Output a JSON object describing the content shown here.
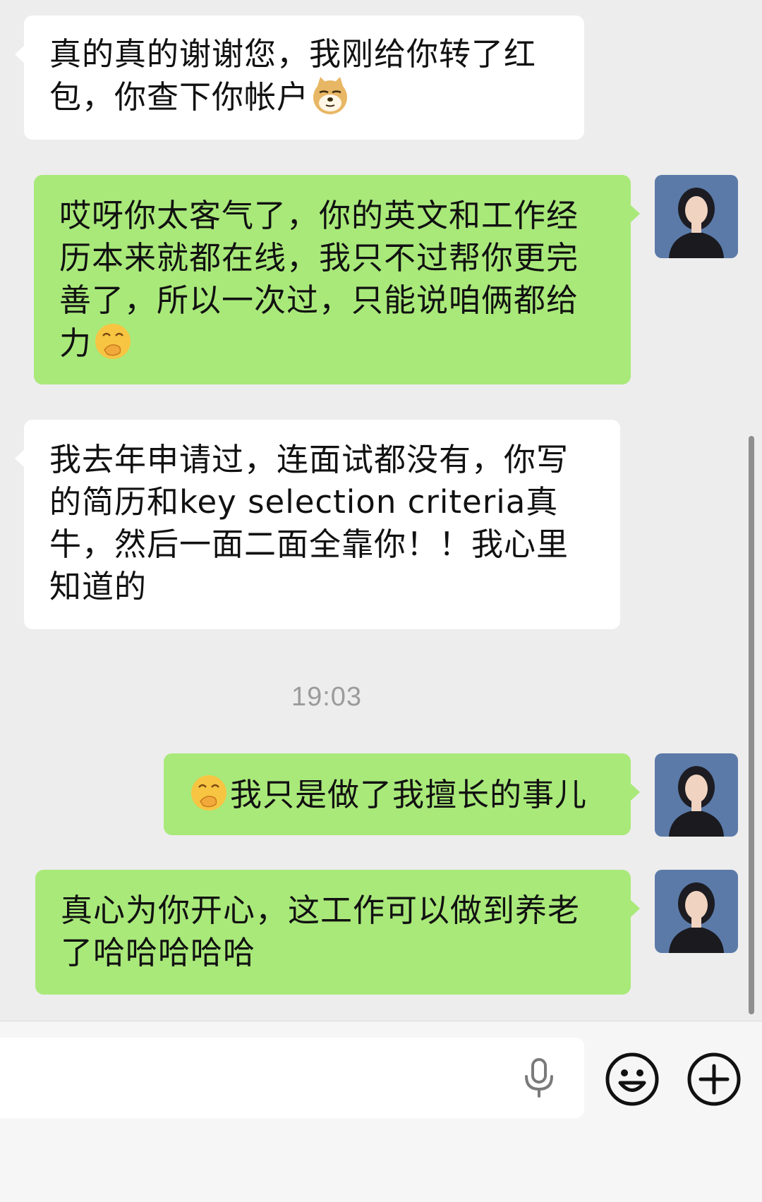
{
  "messages": [
    {
      "sender": "other",
      "text": "真的真的谢谢您，我刚给你转了红包，你查下你帐户",
      "emoji": "doge-emoji"
    },
    {
      "sender": "me",
      "text": "哎呀你太客气了，你的英文和工作经历本来就都在线，我只不过帮你更完善了，所以一次过，只能说咱俩都给力",
      "emoji": "smirk-hand-emoji"
    },
    {
      "sender": "other",
      "text": "我去年申请过，连面试都没有，你写的简历和key selection criteria真牛，然后一面二面全靠你！！我心里知道的"
    },
    {
      "sender": "me",
      "lead_emoji": "smirk-hand-emoji",
      "text": "我只是做了我擅长的事儿"
    },
    {
      "sender": "me",
      "text": "真心为你开心，这工作可以做到养老了哈哈哈哈哈"
    }
  ],
  "timestamp": "19:03",
  "composer": {
    "input_value": "",
    "icons": [
      "microphone-icon",
      "emoji-icon",
      "plus-icon"
    ]
  },
  "colors": {
    "chat_background": "#ededed",
    "incoming_bubble": "#ffffff",
    "outgoing_bubble": "#a9e97a",
    "timestamp_text": "#9b9b9b"
  }
}
